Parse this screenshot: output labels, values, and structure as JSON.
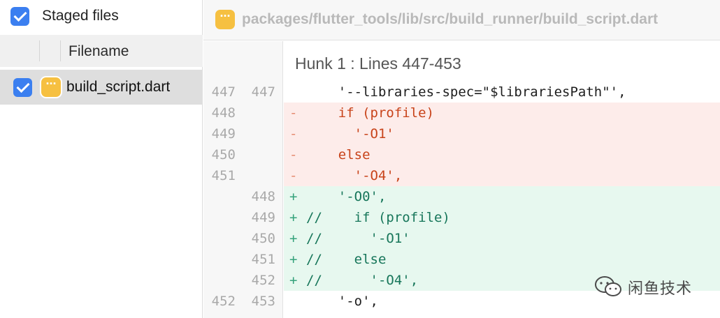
{
  "left_panel": {
    "section_title": "Staged files",
    "section_checked": true,
    "column_header": "Filename",
    "files": [
      {
        "name": "build_script.dart",
        "checked": true,
        "icon": "dart-file-icon"
      }
    ]
  },
  "diff": {
    "file_path": "packages/flutter_tools/lib/src/build_runner/build_script.dart",
    "hunk_title": "Hunk 1 : Lines 447-453",
    "lines": [
      {
        "type": "context",
        "old": "447",
        "new": "447",
        "marker": "",
        "text": "    '--libraries-spec=\"$librariesPath\"',"
      },
      {
        "type": "deletion",
        "old": "448",
        "new": "",
        "marker": "-",
        "text": "    if (profile)"
      },
      {
        "type": "deletion",
        "old": "449",
        "new": "",
        "marker": "-",
        "text": "      '-O1'"
      },
      {
        "type": "deletion",
        "old": "450",
        "new": "",
        "marker": "-",
        "text": "    else"
      },
      {
        "type": "deletion",
        "old": "451",
        "new": "",
        "marker": "-",
        "text": "      '-O4',"
      },
      {
        "type": "addition",
        "old": "",
        "new": "448",
        "marker": "+",
        "text": "    '-O0',"
      },
      {
        "type": "addition",
        "old": "",
        "new": "449",
        "marker": "+",
        "text": "//    if (profile)"
      },
      {
        "type": "addition",
        "old": "",
        "new": "450",
        "marker": "+",
        "text": "//      '-O1'"
      },
      {
        "type": "addition",
        "old": "",
        "new": "451",
        "marker": "+",
        "text": "//    else"
      },
      {
        "type": "addition",
        "old": "",
        "new": "452",
        "marker": "+",
        "text": "//      '-O4',"
      },
      {
        "type": "context",
        "old": "452",
        "new": "453",
        "marker": "",
        "text": "    '-o',"
      }
    ]
  },
  "watermark": {
    "text": "闲鱼技术",
    "icon": "wechat-icon"
  },
  "colors": {
    "checkbox": "#3b7ff0",
    "dart_icon": "#f6c041",
    "deletion_bg": "#fdecea",
    "deletion_text": "#c8431a",
    "addition_bg": "#e7f8ef",
    "addition_text": "#17765a"
  }
}
